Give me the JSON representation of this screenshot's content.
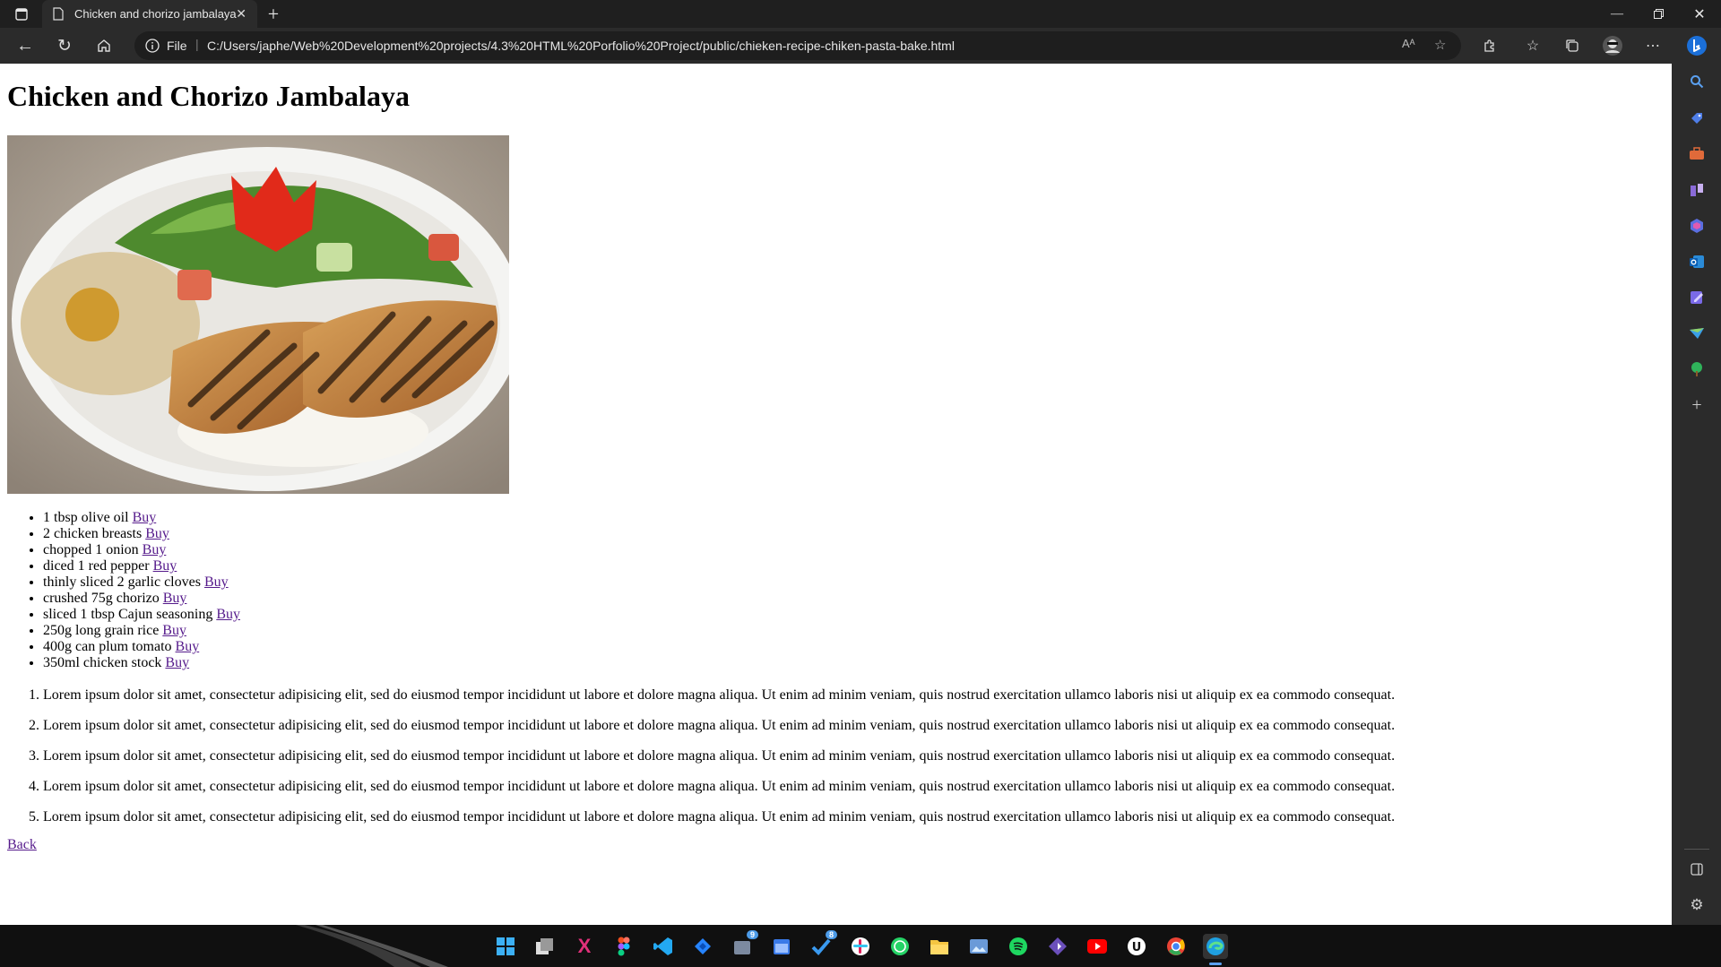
{
  "browser": {
    "tab_title": "Chicken and chorizo jambalaya",
    "address": {
      "scheme_label": "File",
      "url": "C:/Users/japhe/Web%20Development%20projects/4.3%20HTML%20Porfolio%20Project/public/chieken-recipe-chiken-pasta-bake.html"
    }
  },
  "page": {
    "title": "Chicken and Chorizo Jambalaya",
    "image_alt": "Grilled chicken with hummus, rice and salad on a plate",
    "ingredients": [
      {
        "text": "1 tbsp olive oil ",
        "link": "Buy"
      },
      {
        "text": "2 chicken breasts ",
        "link": "Buy"
      },
      {
        "text": "chopped 1 onion ",
        "link": "Buy"
      },
      {
        "text": "diced 1 red pepper ",
        "link": "Buy"
      },
      {
        "text": "thinly sliced 2 garlic cloves ",
        "link": "Buy"
      },
      {
        "text": "crushed 75g chorizo ",
        "link": "Buy"
      },
      {
        "text": "sliced 1 tbsp Cajun seasoning ",
        "link": "Buy"
      },
      {
        "text": "250g long grain rice ",
        "link": "Buy"
      },
      {
        "text": "400g can plum tomato ",
        "link": "Buy"
      },
      {
        "text": "350ml chicken stock ",
        "link": "Buy"
      }
    ],
    "steps": [
      "Lorem ipsum dolor sit amet, consectetur adipisicing elit, sed do eiusmod tempor incididunt ut labore et dolore magna aliqua. Ut enim ad minim veniam, quis nostrud exercitation ullamco laboris nisi ut aliquip ex ea commodo consequat.",
      "Lorem ipsum dolor sit amet, consectetur adipisicing elit, sed do eiusmod tempor incididunt ut labore et dolore magna aliqua. Ut enim ad minim veniam, quis nostrud exercitation ullamco laboris nisi ut aliquip ex ea commodo consequat.",
      "Lorem ipsum dolor sit amet, consectetur adipisicing elit, sed do eiusmod tempor incididunt ut labore et dolore magna aliqua. Ut enim ad minim veniam, quis nostrud exercitation ullamco laboris nisi ut aliquip ex ea commodo consequat.",
      "Lorem ipsum dolor sit amet, consectetur adipisicing elit, sed do eiusmod tempor incididunt ut labore et dolore magna aliqua. Ut enim ad minim veniam, quis nostrud exercitation ullamco laboris nisi ut aliquip ex ea commodo consequat.",
      "Lorem ipsum dolor sit amet, consectetur adipisicing elit, sed do eiusmod tempor incididunt ut labore et dolore magna aliqua. Ut enim ad minim veniam, quis nostrud exercitation ullamco laboris nisi ut aliquip ex ea commodo consequat."
    ],
    "back_link": "Back"
  },
  "colors": {
    "visited_link": "#551a8b",
    "chrome_dark": "#2b2b2b",
    "taskbar": "#101010"
  },
  "taskbar": {
    "badges": {
      "store": "9",
      "tasks": "8"
    }
  }
}
